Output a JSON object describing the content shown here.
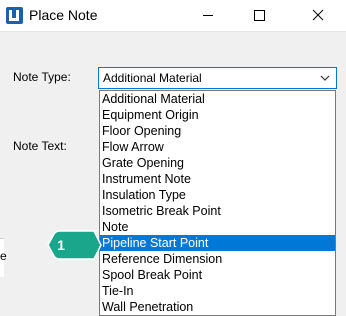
{
  "window": {
    "title": "Place Note"
  },
  "form": {
    "note_type_label": "Note Type:",
    "note_text_label": "Note Text:",
    "edge_label": "e"
  },
  "note_type_select": {
    "value": "Additional Material",
    "options": [
      "Additional Material",
      "Equipment Origin",
      "Floor Opening",
      "Flow Arrow",
      "Grate Opening",
      "Instrument Note",
      "Insulation Type",
      "Isometric Break Point",
      "Note",
      "Pipeline Start Point",
      "Reference Dimension",
      "Spool Break Point",
      "Tie-In",
      "Wall Penetration"
    ],
    "highlighted": "Pipeline Start Point"
  },
  "callout": {
    "number": "1",
    "color": "#1aa68a"
  },
  "colors": {
    "accent": "#0078d7",
    "app_icon": "#1e5fa8"
  },
  "icons": [
    "app-icon",
    "minimize-icon",
    "maximize-icon",
    "close-icon",
    "chevron-down-icon"
  ]
}
